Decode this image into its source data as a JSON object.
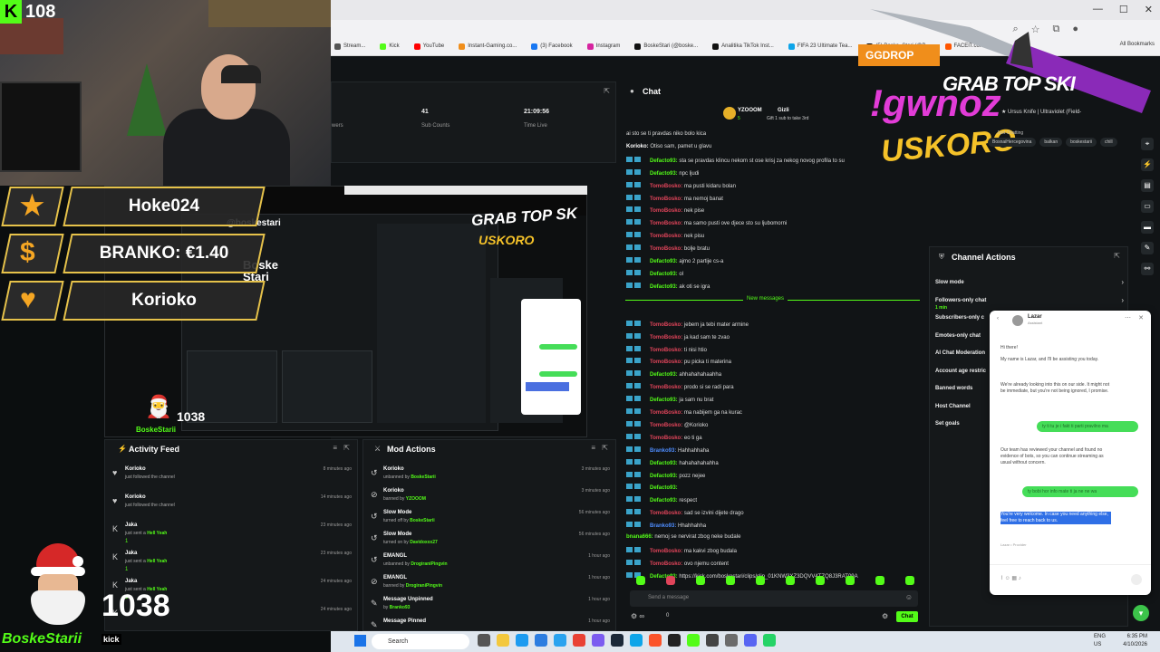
{
  "webcam": {
    "kick_count": "108"
  },
  "overlay": {
    "rows": [
      {
        "label": "Hoke024",
        "icon": "star-icon",
        "symbol": "★",
        "color": "#f5a623"
      },
      {
        "label": "BRANKO: €1.40",
        "icon": "dollar-icon",
        "symbol": "$",
        "color": "#f5a623"
      },
      {
        "label": "Korioko",
        "icon": "heart-icon",
        "symbol": "♥",
        "color": "#f5a623"
      }
    ]
  },
  "browser": {
    "bookmarks": [
      "Stream...",
      "Kick",
      "YouTube",
      "Instant-Gaming.co...",
      "(3) Facebook",
      "Instagram",
      "BoskeStari (@boske...",
      "Analitika TikTok Inst...",
      "FIFA 23 Ultimate Tea...",
      "(5) Boske_Stari (@B...",
      "FACEIT.com"
    ],
    "all_bookmarks": "All Bookmarks"
  },
  "stats": {
    "followers_label": "wers",
    "sub_counts_value": "41",
    "sub_counts_label": "Sub Counts",
    "time_live_value": "21:09:56",
    "time_live_label": "Time Live"
  },
  "preview": {
    "instagram_handle": "@boskestari",
    "handle_line1": "Boske",
    "handle_line2": "Stari",
    "grab_text": "GRAB TOP SK",
    "uskoro_text": "USKORO",
    "santa_count": "1038",
    "tag": "BoskeStarii"
  },
  "activity_feed": {
    "title": "Activity Feed",
    "items": [
      {
        "icon": "heart-icon",
        "glyph": "♥",
        "name": "Korioko",
        "sub": "just followed the channel",
        "time": "8 minutes ago"
      },
      {
        "icon": "heart-icon",
        "glyph": "♥",
        "name": "Korioko",
        "sub": "just followed the channel",
        "time": "14 minutes ago"
      },
      {
        "icon": "kick-icon",
        "glyph": "K",
        "name": "Jaka",
        "sub": "just sent a",
        "tier": "Hell Yeah",
        "time": "23 minutes ago",
        "gift": "1"
      },
      {
        "icon": "kick-icon",
        "glyph": "K",
        "name": "Jaka",
        "sub": "just sent a",
        "tier": "Hell Yeah",
        "time": "23 minutes ago",
        "gift": "1"
      },
      {
        "icon": "kick-icon",
        "glyph": "K",
        "name": "Jaka",
        "sub": "just sent a",
        "tier": "Hell Yeah",
        "time": "24 minutes ago",
        "gift": "1"
      },
      {
        "icon": "kick-icon",
        "glyph": "K",
        "name": "",
        "sub": "",
        "time": "24 minutes ago"
      }
    ]
  },
  "mod_actions": {
    "title": "Mod Actions",
    "items": [
      {
        "glyph": "↺",
        "name": "Korioko",
        "sub": "unbanned by",
        "by": "BoskeStarii",
        "time": "3 minutes ago"
      },
      {
        "glyph": "⊘",
        "name": "Korioko",
        "sub": "banned by",
        "by": "YZOOOM",
        "time": "3 minutes ago"
      },
      {
        "glyph": "↺",
        "name": "Slow Mode",
        "sub": "turned off by",
        "by": "BoskeStarii",
        "time": "56 minutes ago"
      },
      {
        "glyph": "↺",
        "name": "Slow Mode",
        "sub": "turned on by",
        "by": "Davidoxxx27",
        "time": "56 minutes ago"
      },
      {
        "glyph": "↺",
        "name": "EMANGL",
        "sub": "unbanned by",
        "by": "DrogiraniPingvin",
        "time": "1 hour ago"
      },
      {
        "glyph": "⊘",
        "name": "EMANGL",
        "sub": "banned by",
        "by": "DrogiraniPingvin",
        "time": "1 hour ago"
      },
      {
        "glyph": "✎",
        "name": "Message Unpinned",
        "sub": "by",
        "by": "Branko93",
        "time": "1 hour ago"
      },
      {
        "glyph": "✎",
        "name": "Message Pinned",
        "sub": "",
        "by": "",
        "time": "1 hour ago"
      }
    ]
  },
  "chat": {
    "title": "Chat",
    "pinned_user": "YZOOOM",
    "pinned_gift_user": "Gizli",
    "pinned_text": "Gift 1 sub to take 3rd",
    "pinned_count": "5",
    "new_messages_label": "New messages",
    "input_placeholder": "Send a message",
    "send_label": "Chat",
    "viewer_count": "0",
    "lines": [
      {
        "user": "",
        "color": "u-white",
        "badges": false,
        "text": "ai sto se ti pravdas niko bolo kica"
      },
      {
        "user": "Korioko:",
        "color": "u-white",
        "badges": false,
        "text": " Otiso sam, pamet u glavu"
      },
      {
        "user": "Defacto93:",
        "color": "u-green",
        "badges": true,
        "text": " sta se pravdas klincu nekom st ose krisj za nekog novog profila to su"
      },
      {
        "user": "Defacto93:",
        "color": "u-green",
        "badges": true,
        "text": " npc ljudi"
      },
      {
        "user": "TomoBosko:",
        "color": "u-red",
        "badges": true,
        "text": " ma pusti kidaru bolan"
      },
      {
        "user": "TomoBosko:",
        "color": "u-red",
        "badges": true,
        "text": " ma nemoj banat"
      },
      {
        "user": "TomoBosko:",
        "color": "u-red",
        "badges": true,
        "text": " nek pise"
      },
      {
        "user": "TomoBosko:",
        "color": "u-red",
        "badges": true,
        "text": " ma samo pusti ove djece sto su ljubomorni"
      },
      {
        "user": "TomoBosko:",
        "color": "u-red",
        "badges": true,
        "text": " nek pisu"
      },
      {
        "user": "TomoBosko:",
        "color": "u-red",
        "badges": true,
        "text": " bolje bratu"
      },
      {
        "user": "Defacto93:",
        "color": "u-green",
        "badges": true,
        "text": " ajmo 2 partije cs-a"
      },
      {
        "user": "Defacto93:",
        "color": "u-green",
        "badges": true,
        "text": " ol"
      },
      {
        "user": "Defacto93:",
        "color": "u-green",
        "badges": true,
        "text": " ak oti se igra"
      },
      {
        "user": "TomoBosko:",
        "color": "u-red",
        "badges": true,
        "text": " jebem ja tebi mater armine"
      },
      {
        "user": "TomoBosko:",
        "color": "u-red",
        "badges": true,
        "text": " ja kad sam te zvao"
      },
      {
        "user": "TomoBosko:",
        "color": "u-red",
        "badges": true,
        "text": " ti nisi htio"
      },
      {
        "user": "TomoBosko:",
        "color": "u-red",
        "badges": true,
        "text": " pu picka ti materina"
      },
      {
        "user": "Defacto93:",
        "color": "u-green",
        "badges": true,
        "text": " ahhahahahaahha"
      },
      {
        "user": "TomoBosko:",
        "color": "u-red",
        "badges": true,
        "text": " prodo si se radi para"
      },
      {
        "user": "Defacto93:",
        "color": "u-green",
        "badges": true,
        "text": " ja sam nu brat"
      },
      {
        "user": "TomoBosko:",
        "color": "u-red",
        "badges": true,
        "text": " ma nabijem ga na kurac"
      },
      {
        "user": "TomoBosko:",
        "color": "u-red",
        "badges": true,
        "text": " @Korioko"
      },
      {
        "user": "TomoBosko:",
        "color": "u-red",
        "badges": true,
        "text": " eo ti ga"
      },
      {
        "user": "Branko93:",
        "color": "u-blue",
        "badges": true,
        "text": " Hahhahhaha"
      },
      {
        "user": "Defacto93:",
        "color": "u-green",
        "badges": true,
        "text": " hahahahahahha"
      },
      {
        "user": "Defacto93:",
        "color": "u-green",
        "badges": true,
        "text": " pozz nejee"
      },
      {
        "user": "Defacto93:",
        "color": "u-green",
        "badges": true,
        "text": " "
      },
      {
        "user": "Defacto93:",
        "color": "u-green",
        "badges": true,
        "text": " respect"
      },
      {
        "user": "TomoBosko:",
        "color": "u-red",
        "badges": true,
        "text": " sad se izvini dijete drago"
      },
      {
        "user": "Branko93:",
        "color": "u-blue",
        "badges": true,
        "text": " Hhahhahha"
      },
      {
        "user": "bnana666:",
        "color": "u-green",
        "badges": false,
        "text": " nemoj se nervirat zbog neke budale"
      },
      {
        "user": "TomoBosko:",
        "color": "u-red",
        "badges": true,
        "text": " ma kakvi zbog budala"
      },
      {
        "user": "TomoBosko:",
        "color": "u-red",
        "badges": true,
        "text": " ovo njemu content"
      },
      {
        "user": "Defacto93:",
        "color": "u-green",
        "badges": true,
        "text": " https://kick.com/boskestari/clips/clip_01KNW3XZ3DQVV4TZQ8J3RAT09A"
      }
    ]
  },
  "game_overlay": {
    "ggdrop": "GGDROP",
    "grab": "GRAB TOP SKI",
    "gwnoz": "!gwnoz",
    "uskoro": "USKORO",
    "ursus": "★ Ursus Knife | Ultraviolet (Field-"
  },
  "tags": [
    "BosnaiHercegovina",
    "balkan",
    "boskestarii",
    "chill"
  ],
  "just_chatting": "Just Chatting",
  "channel_actions": {
    "title": "Channel Actions",
    "items": [
      {
        "label": "Slow mode",
        "chevron": true
      },
      {
        "label": "Followers-only chat",
        "chevron": true,
        "sub": "1 min"
      },
      {
        "label": "Subscribers-only c",
        "chevron": false
      },
      {
        "label": "Emotes-only chat",
        "chevron": false
      },
      {
        "label": "AI Chat Moderation",
        "chevron": false
      },
      {
        "label": "Account age restric",
        "chevron": false
      },
      {
        "label": "Banned words",
        "chevron": false
      },
      {
        "label": "Host Channel",
        "chevron": false
      },
      {
        "label": "Set goals",
        "chevron": false
      }
    ]
  },
  "support": {
    "agent": "Lazar",
    "role": "Assistant",
    "m1": "Hi there!",
    "m2": "My name is Lazar, and I'll be assisting you today.",
    "m3": "We're already looking into this on our side. It might not be immediate, but you're not being ignored, I promise.",
    "out1": "ty ti tu je i fakt ti parti pravilno ma",
    "m4": "Our team has reviewed your channel and found no evidence of bots, so you can continue streaming as usual without concern.",
    "out2": "ty bobi hor info mate ti ja ne ne wa",
    "m5": "You're very welcome. In case you need anything else, feel free to reach back to us.",
    "footer": "Lazar • Provider"
  },
  "host": {
    "count": "1038",
    "name": "BoskeStarii",
    "kick": "kick"
  },
  "taskbar": {
    "search": "Search",
    "lang1": "ENG",
    "lang2": "US",
    "time": "6:35 PM",
    "date": "4/10/2026"
  }
}
